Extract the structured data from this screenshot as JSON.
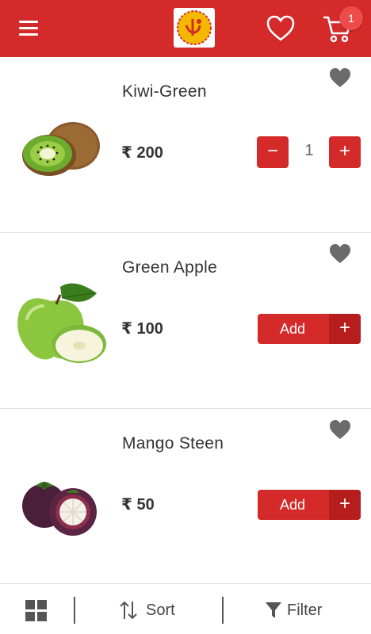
{
  "header": {
    "menu_icon": "hamburger-menu-icon",
    "logo_icon": "store-logo-icon",
    "wishlist_icon": "heart-outline-icon",
    "cart_icon": "shopping-cart-icon",
    "cart_count": "1"
  },
  "products": [
    {
      "name": "Kiwi-Green",
      "price": "₹ 200",
      "favorite_icon": "heart-filled-icon",
      "quantity": "1",
      "minus_label": "−",
      "plus_label": "+"
    },
    {
      "name": "Green Apple",
      "price": "₹ 100",
      "favorite_icon": "heart-filled-icon",
      "add_label": "Add",
      "plus_label": "+"
    },
    {
      "name": "Mango Steen",
      "price": "₹ 50",
      "favorite_icon": "heart-filled-icon",
      "add_label": "Add",
      "plus_label": "+"
    }
  ],
  "bottom_bar": {
    "grid_icon": "grid-view-icon",
    "sort_label": "Sort",
    "sort_icon": "sort-arrows-icon",
    "filter_label": "Filter",
    "filter_icon": "filter-funnel-icon"
  },
  "colors": {
    "brand_red": "#d42a2a",
    "brand_dark_red": "#b61e1e",
    "badge": "#ee4b4b",
    "logo_yellow": "#f5b800"
  }
}
